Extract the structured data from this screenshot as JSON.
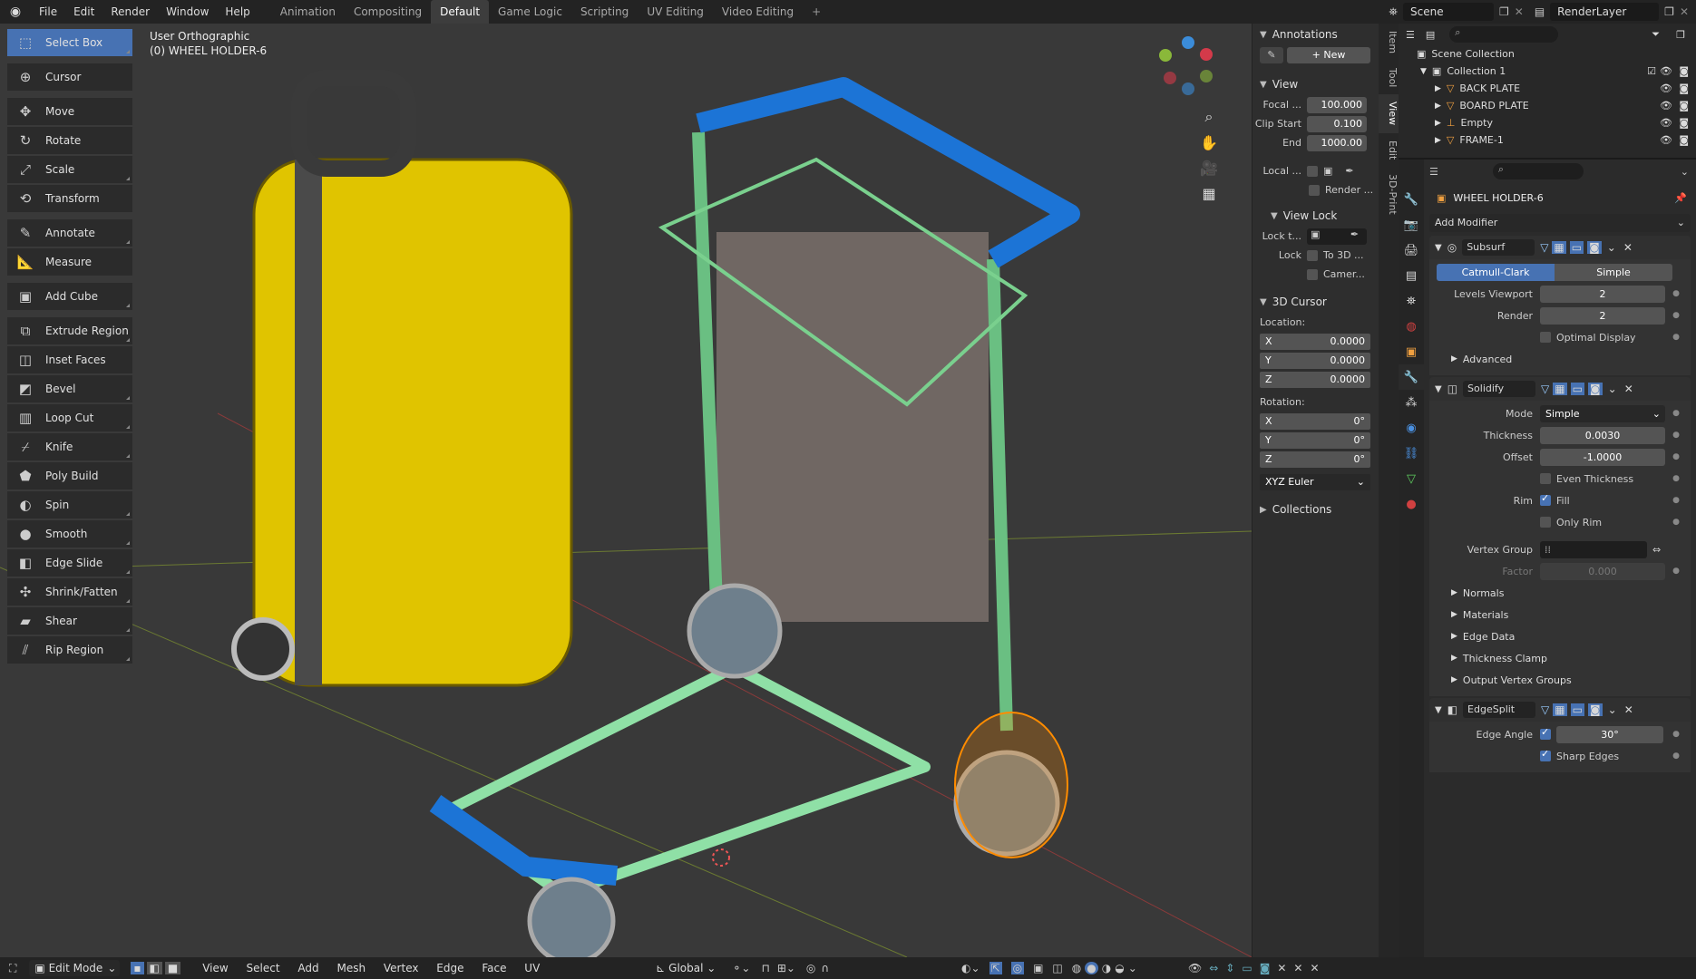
{
  "menu": [
    "File",
    "Edit",
    "Render",
    "Window",
    "Help"
  ],
  "workspaces": [
    "Animation",
    "Compositing",
    "Default",
    "Game Logic",
    "Scripting",
    "UV Editing",
    "Video Editing"
  ],
  "active_workspace": "Default",
  "scene": "Scene",
  "render_layer": "RenderLayer",
  "viewport": {
    "title": "User Orthographic",
    "object": "(0) WHEEL HOLDER-6"
  },
  "tools": [
    "Select Box",
    "Cursor",
    "Move",
    "Rotate",
    "Scale",
    "Transform",
    "Annotate",
    "Measure",
    "Add Cube",
    "Extrude Region",
    "Inset Faces",
    "Bevel",
    "Loop Cut",
    "Knife",
    "Poly Build",
    "Spin",
    "Smooth",
    "Edge Slide",
    "Shrink/Fatten",
    "Shear",
    "Rip Region"
  ],
  "npanel": {
    "annotations": "Annotations",
    "new": "New",
    "view": "View",
    "focal_label": "Focal ...",
    "focal": "100.000",
    "clip_start_label": "Clip Start",
    "clip_start": "0.100",
    "end_label": "End",
    "end": "1000.00",
    "local_label": "Local ...",
    "render_label": "Render ...",
    "view_lock": "View Lock",
    "lock_t": "Lock t...",
    "lock": "Lock",
    "to3d": "To 3D ...",
    "camera": "Camer...",
    "cursor3d": "3D Cursor",
    "location": "Location:",
    "rotation": "Rotation:",
    "loc": [
      "0.0000",
      "0.0000",
      "0.0000"
    ],
    "rot": [
      "0°",
      "0°",
      "0°"
    ],
    "axes": [
      "X",
      "Y",
      "Z"
    ],
    "euler": "XYZ Euler",
    "collections": "Collections"
  },
  "vtabs": [
    "Item",
    "Tool",
    "View",
    "Edit",
    "3D-Print"
  ],
  "outliner": {
    "scene_collection": "Scene Collection",
    "collection": "Collection 1",
    "items": [
      "BACK PLATE",
      "BOARD PLATE",
      "Empty",
      "FRAME-1"
    ]
  },
  "props": {
    "object": "WHEEL HOLDER-6",
    "add_modifier": "Add Modifier",
    "subsurf": {
      "name": "Subsurf",
      "tab1": "Catmull-Clark",
      "tab2": "Simple",
      "levels_label": "Levels Viewport",
      "levels": "2",
      "render_label": "Render",
      "render": "2",
      "optimal": "Optimal Display",
      "advanced": "Advanced"
    },
    "solidify": {
      "name": "Solidify",
      "mode_label": "Mode",
      "mode": "Simple",
      "thickness_label": "Thickness",
      "thickness": "0.0030",
      "offset_label": "Offset",
      "offset": "-1.0000",
      "even": "Even Thickness",
      "rim_label": "Rim",
      "fill": "Fill",
      "only_rim": "Only Rim",
      "vgroup_label": "Vertex Group",
      "factor_label": "Factor",
      "factor": "0.000",
      "subs": [
        "Normals",
        "Materials",
        "Edge Data",
        "Thickness Clamp",
        "Output Vertex Groups"
      ]
    },
    "edgesplit": {
      "name": "EdgeSplit",
      "angle_label": "Edge Angle",
      "angle": "30°",
      "sharp": "Sharp Edges"
    }
  },
  "statusbar": {
    "mode": "Edit Mode",
    "menus": [
      "View",
      "Select",
      "Add",
      "Mesh",
      "Vertex",
      "Edge",
      "Face",
      "UV"
    ],
    "orientation": "Global"
  },
  "colors": {
    "accent": "#4772b3",
    "viewport": "#393939",
    "selected": "#ff8c00"
  }
}
